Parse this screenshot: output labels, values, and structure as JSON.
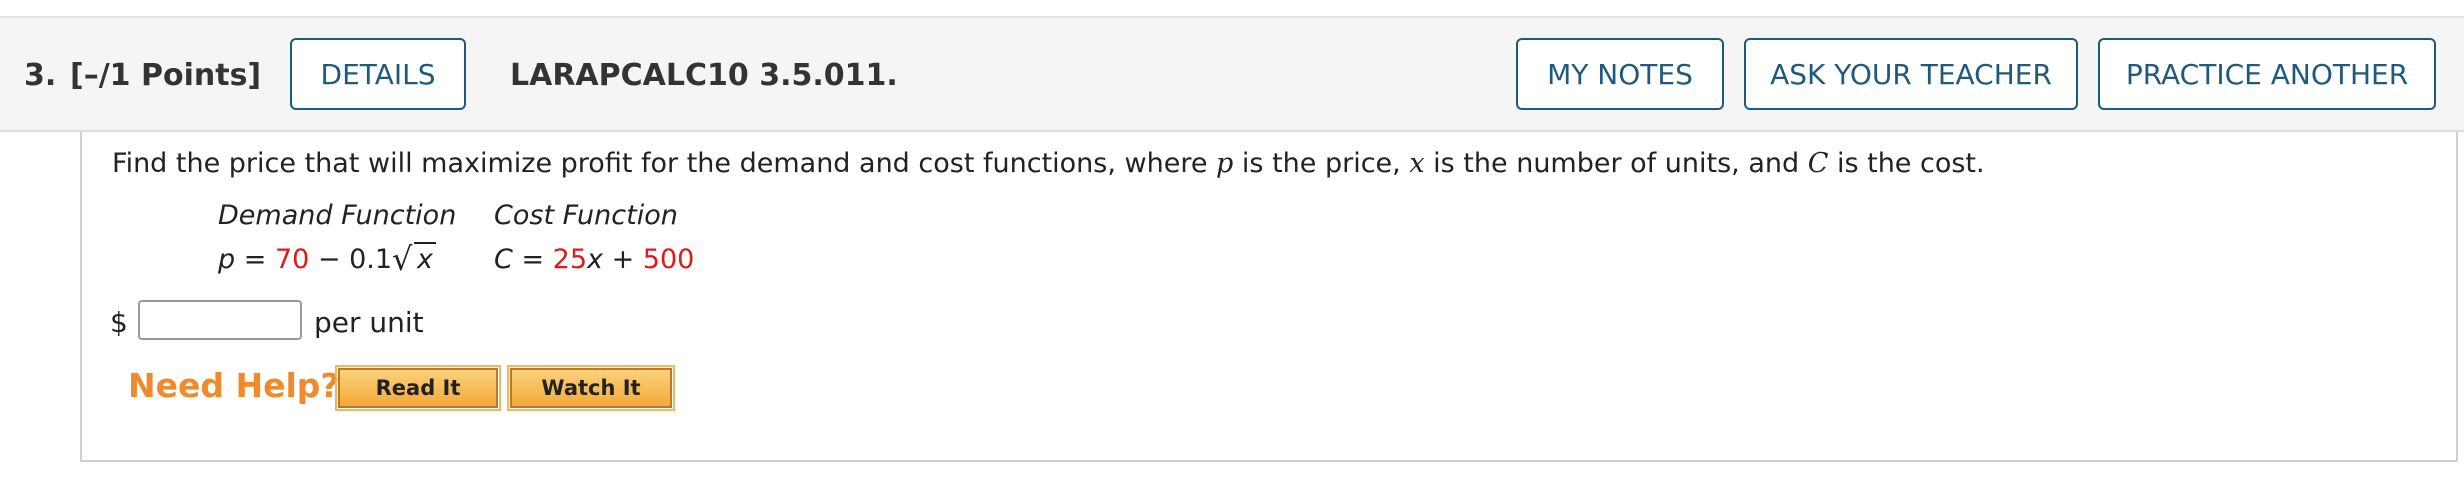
{
  "header": {
    "number": "3.",
    "points": "[–/1 Points]",
    "details_label": "DETAILS",
    "code": "LARAPCALC10 3.5.011.",
    "my_notes_label": "MY NOTES",
    "ask_teacher_label": "ASK YOUR TEACHER",
    "practice_label": "PRACTICE ANOTHER"
  },
  "question": {
    "prompt_parts": [
      "Find the price that will maximize profit for the demand and cost functions, where ",
      "p",
      " is the price, ",
      "x",
      " is the number of units, and ",
      "C",
      " is the cost."
    ],
    "demand_head": "Demand Function",
    "cost_head": "Cost Function",
    "demand_lhs": "p",
    "demand_eq": " = ",
    "demand_a": "70",
    "demand_minus": " − 0.1",
    "demand_var": "x",
    "cost_lhs": "C",
    "cost_eq": " = ",
    "cost_a": "25",
    "cost_var": "x",
    "cost_plus": " + ",
    "cost_b": "500"
  },
  "answer": {
    "currency": "$",
    "value": "",
    "unit": "per unit"
  },
  "help": {
    "label": "Need Help?",
    "read_it": "Read It",
    "watch_it": "Watch It"
  }
}
